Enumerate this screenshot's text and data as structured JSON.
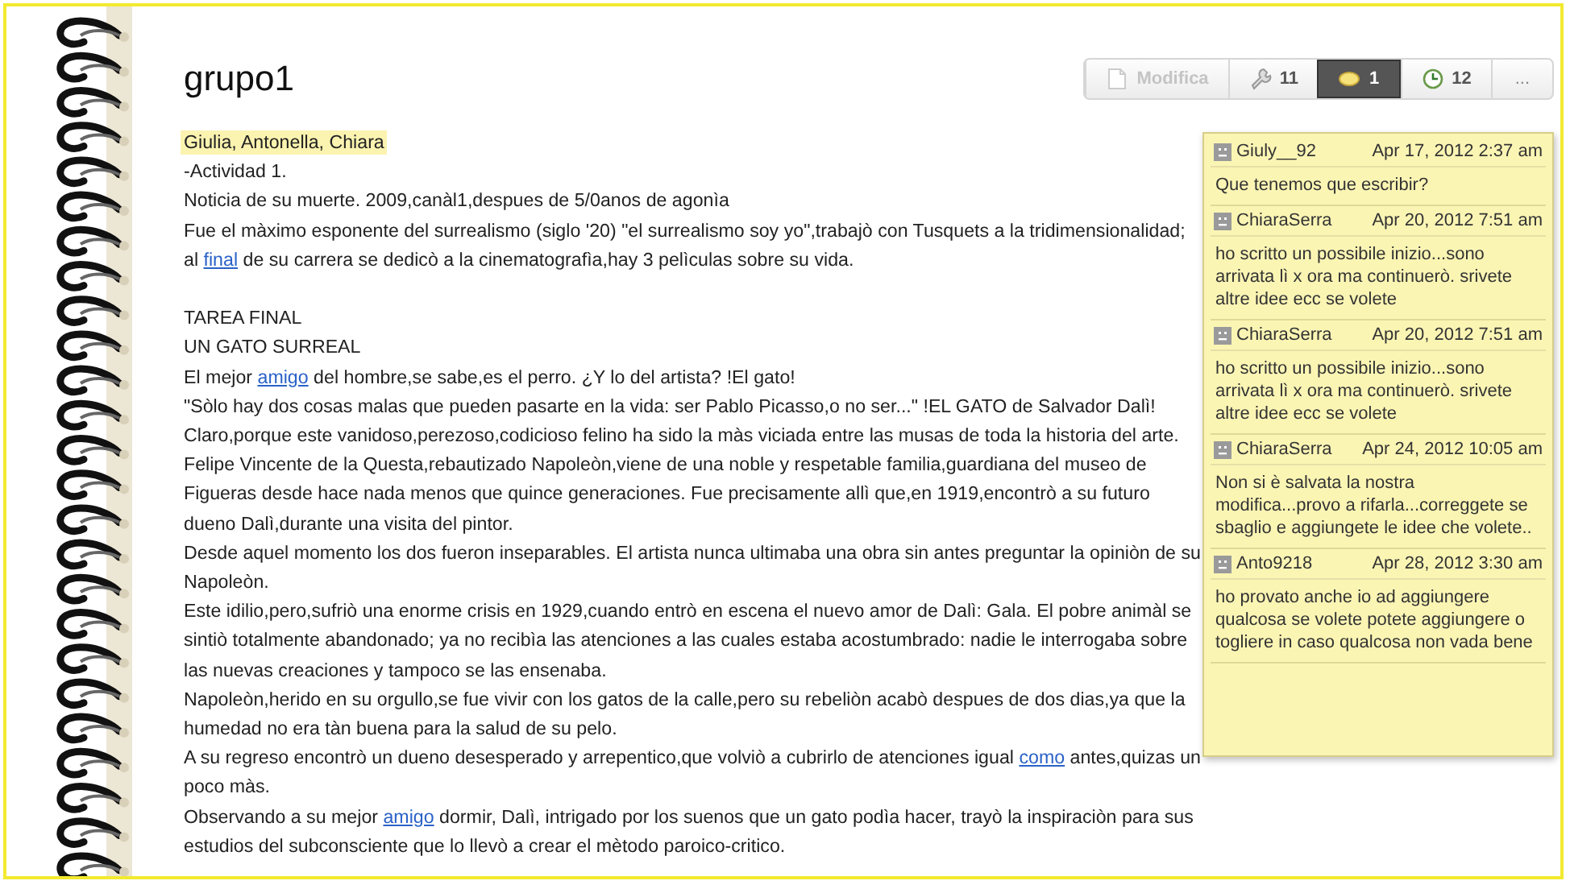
{
  "page": {
    "title": "grupo1"
  },
  "toolbar": [
    {
      "kind": "edit",
      "label": "Modifica",
      "disabled": true,
      "selected": false
    },
    {
      "kind": "tools",
      "label": "11",
      "disabled": false,
      "selected": false
    },
    {
      "kind": "comments",
      "label": "1",
      "disabled": false,
      "selected": true
    },
    {
      "kind": "history",
      "label": "12",
      "disabled": false,
      "selected": false
    },
    {
      "kind": "more",
      "label": "...",
      "disabled": false,
      "selected": false
    }
  ],
  "paragraphs": [
    {
      "highlighted": true,
      "parts": [
        {
          "kind": "text",
          "text": "Giulia, Antonella, Chiara"
        }
      ]
    },
    {
      "highlighted": false,
      "parts": [
        {
          "kind": "text",
          "text": "-Actividad 1."
        }
      ]
    },
    {
      "highlighted": false,
      "parts": [
        {
          "kind": "text",
          "text": "Noticia de su muerte. 2009,canàl1,despues de 5/0anos de agonìa"
        }
      ]
    },
    {
      "highlighted": false,
      "parts": [
        {
          "kind": "text",
          "text": "Fue el màximo esponente del surrealismo (siglo '20) \"el surrealismo soy yo\",trabajò con Tusquets a la tridimensionalidad; al "
        },
        {
          "kind": "link",
          "text": "final"
        },
        {
          "kind": "text",
          "text": " de su carrera se dedicò a la cinematografìa,hay 3 pelìculas sobre su vida."
        }
      ]
    },
    {
      "highlighted": false,
      "parts": [
        {
          "kind": "text",
          "text": "TAREA FINAL"
        }
      ]
    },
    {
      "highlighted": false,
      "parts": [
        {
          "kind": "text",
          "text": "UN GATO SURREAL"
        }
      ]
    },
    {
      "highlighted": false,
      "parts": [
        {
          "kind": "text",
          "text": "El mejor "
        },
        {
          "kind": "link",
          "text": "amigo"
        },
        {
          "kind": "text",
          "text": " del hombre,se sabe,es el perro. ¿Y lo del artista? !El gato!"
        }
      ]
    },
    {
      "highlighted": false,
      "parts": [
        {
          "kind": "text",
          "text": "\"Sòlo hay dos cosas malas que pueden pasarte en la vida: ser Pablo Picasso,o no ser...\" !EL GATO de Salvador Dalì! Claro,porque este vanidoso,perezoso,codicioso felino ha sido la màs viciada entre las musas de toda la historia del arte."
        }
      ]
    },
    {
      "highlighted": false,
      "parts": [
        {
          "kind": "text",
          "text": "Felipe Vincente de la Questa,rebautizado Napoleòn,viene de una noble y respetable familia,guardiana del museo de Figueras desde hace nada menos que quince generaciones. Fue precisamente allì que,en 1919,encontrò a su futuro dueno Dalì,durante una visita del pintor."
        }
      ]
    },
    {
      "highlighted": false,
      "parts": [
        {
          "kind": "text",
          "text": "Desde aquel momento los dos fueron inseparables. El artista nunca ultimaba una obra sin antes preguntar la opiniòn de su Napoleòn."
        }
      ]
    },
    {
      "highlighted": false,
      "parts": [
        {
          "kind": "text",
          "text": "Este idilio,pero,sufriò una enorme crisis en 1929,cuando entrò en escena el nuevo amor de Dalì: Gala. El pobre animàl se sintiò totalmente abandonado; ya no recibìa las atenciones a las cuales estaba acostumbrado: nadie le interrogaba sobre las nuevas creaciones y tampoco se las ensenaba."
        }
      ]
    },
    {
      "highlighted": false,
      "parts": [
        {
          "kind": "text",
          "text": "Napoleòn,herido en su orgullo,se fue vivir con los gatos de la calle,pero su rebeliòn acabò despues de dos dias,ya que la humedad no era tàn buena para la salud de su pelo."
        }
      ]
    },
    {
      "highlighted": false,
      "parts": [
        {
          "kind": "text",
          "text": "A su regreso encontrò un dueno desesperado y arrepentico,que volviò a cubrirlo de atenciones igual "
        },
        {
          "kind": "link",
          "text": "como"
        },
        {
          "kind": "text",
          "text": " antes,quizas un poco màs."
        }
      ]
    },
    {
      "highlighted": false,
      "parts": [
        {
          "kind": "text",
          "text": "Observando a su mejor "
        },
        {
          "kind": "link",
          "text": "amigo"
        },
        {
          "kind": "text",
          "text": " dormir, Dalì, intrigado por los suenos que un gato podìa hacer, trayò la inspiraciòn para sus estudios del subconsciente que lo llevò a crear el mètodo paroico-critico."
        }
      ]
    }
  ],
  "comments": [
    {
      "user": "Giuly__92",
      "date": "Apr 17, 2012 2:37 am",
      "text": "Que tenemos que escribir?"
    },
    {
      "user": "ChiaraSerra",
      "date": "Apr 20, 2012 7:51 am",
      "text": "ho scritto un possibile inizio...sono arrivata lì x ora ma continuerò. srivete altre idee ecc se volete"
    },
    {
      "user": "ChiaraSerra",
      "date": "Apr 20, 2012 7:51 am",
      "text": "ho scritto un possibile inizio...sono arrivata lì x ora ma continuerò. srivete altre idee ecc se volete"
    },
    {
      "user": "ChiaraSerra",
      "date": "Apr 24, 2012 10:05 am",
      "text": "Non si è salvata la nostra modifica...provo a rifarla...correggete se sbaglio e aggiungete le idee che volete.."
    },
    {
      "user": "Anto9218",
      "date": "Apr 28, 2012 3:30 am",
      "text": "ho provato anche io ad aggiungere qualcosa se volete potete aggiungere o togliere in caso qualcosa non vada bene"
    }
  ]
}
